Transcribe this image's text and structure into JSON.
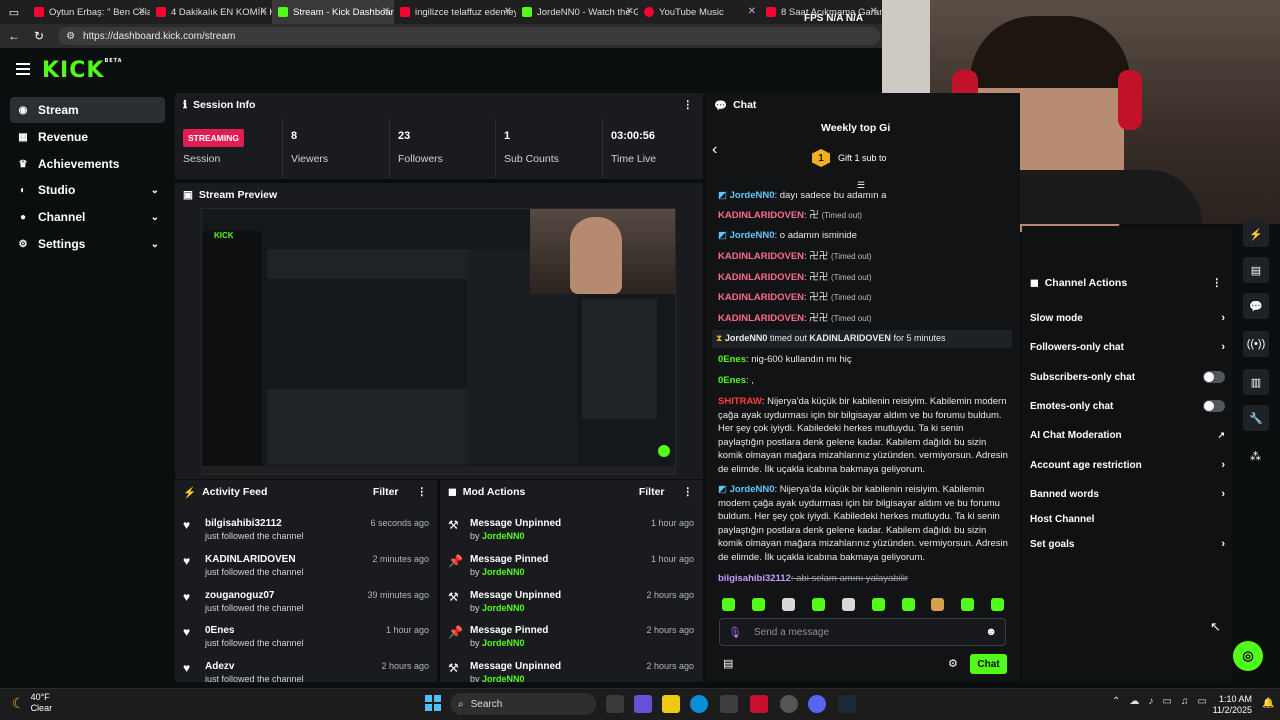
{
  "browser": {
    "tabs": [
      {
        "label": "Oytun Erbaş: \" Ben Celal",
        "color": "#ff0033"
      },
      {
        "label": "4 Dakikalık EN KOMİK Kont",
        "color": "#ff0033"
      },
      {
        "label": "Stream - Kick Dashboard",
        "color": "#53fc18"
      },
      {
        "label": "ingilizce telaffuz edemeyince",
        "color": "#ff0033"
      },
      {
        "label": "JordeNN0 - Watch the Game",
        "color": "#53fc18"
      },
      {
        "label": "YouTube Music",
        "color": "#ff0033"
      },
      {
        "label": "8 Saat Acıkmama Garantili",
        "color": "#ff0033"
      }
    ],
    "url": "https://dashboard.kick.com/stream"
  },
  "overlay": {
    "fps": "FPS",
    "na1": "N/A",
    "na2": "N/A"
  },
  "app": {
    "logo": "KICK",
    "beta": "BETA"
  },
  "sidebar": {
    "items": [
      {
        "label": "Stream",
        "icon": "broadcast-icon"
      },
      {
        "label": "Revenue",
        "icon": "bank-icon"
      },
      {
        "label": "Achievements",
        "icon": "trophy-icon"
      },
      {
        "label": "Studio",
        "icon": "palette-icon"
      },
      {
        "label": "Channel",
        "icon": "user-icon"
      },
      {
        "label": "Settings",
        "icon": "gear-icon"
      }
    ]
  },
  "session": {
    "title": "Session Info",
    "badge": "STREAMING",
    "session_label": "Session",
    "stats": [
      {
        "value": "8",
        "label": "Viewers"
      },
      {
        "value": "23",
        "label": "Followers"
      },
      {
        "value": "1",
        "label": "Sub Counts"
      },
      {
        "value": "03:00:56",
        "label": "Time Live"
      }
    ]
  },
  "preview": {
    "title": "Stream Preview"
  },
  "activity": {
    "title": "Activity Feed",
    "filter": "Filter",
    "items": [
      {
        "name": "bilgisahibi32112",
        "sub": "just followed the channel",
        "time": "6 seconds ago"
      },
      {
        "name": "KADINLARIDOVEN",
        "sub": "just followed the channel",
        "time": "2 minutes ago"
      },
      {
        "name": "zouganoguz07",
        "sub": "just followed the channel",
        "time": "39 minutes ago"
      },
      {
        "name": "0Enes",
        "sub": "just followed the channel",
        "time": "1 hour ago"
      },
      {
        "name": "Adezv",
        "sub": "just followed the channel",
        "time": "2 hours ago"
      }
    ]
  },
  "mod": {
    "title": "Mod Actions",
    "filter": "Filter",
    "by": "by",
    "items": [
      {
        "name": "Message Unpinned",
        "user": "JordeNN0",
        "time": "1 hour ago"
      },
      {
        "name": "Message Pinned",
        "user": "JordeNN0",
        "time": "1 hour ago"
      },
      {
        "name": "Message Unpinned",
        "user": "JordeNN0",
        "time": "2 hours ago"
      },
      {
        "name": "Message Pinned",
        "user": "JordeNN0",
        "time": "2 hours ago"
      },
      {
        "name": "Message Unpinned",
        "user": "JordeNN0",
        "time": "2 hours ago"
      }
    ]
  },
  "chat": {
    "title": "Chat",
    "gifter_title": "Weekly top Gi",
    "gift_text": "Gift 1 sub to",
    "gift_num": "1",
    "timeout": "(Timed out)",
    "messages": [
      {
        "user": "JordeNN0",
        "text": ": dayı sadece bu adamın a"
      },
      {
        "user": "KADINLARIDOVEN",
        "text": ": 卍"
      },
      {
        "user": "JordeNN0",
        "text": ": o adamın isminide"
      },
      {
        "user": "KADINLARIDOVEN",
        "text": ": 卍卍"
      },
      {
        "user": "KADINLARIDOVEN",
        "text": ": 卍卍"
      },
      {
        "user": "KADINLARIDOVEN",
        "text": ": 卍卍"
      },
      {
        "user": "KADINLARIDOVEN",
        "text": ": 卍卍"
      }
    ],
    "timeout_event": {
      "mod": "JordeNN0",
      "mid": "timed out",
      "target": "KADINLARIDOVEN",
      "tail": "for 5 minutes"
    },
    "m2": [
      {
        "user": "0Enes",
        "text": ": nig-600 kullandın mı hiç"
      },
      {
        "user": "0Enes",
        "text": ": ,"
      }
    ],
    "long1_user": "SHITRAW",
    "long1": ": Nijerya'da küçük bir kabilenin reisiyim. Kabilemin modern çağa ayak uydurması için bir bilgisayar aldım ve bu forumu buldum. Her şey çok iyiydi. Kabiledeki herkes mutluydu. Ta ki senin paylaştığın postlara denk gelene kadar. Kabilem dağıldı bu sizin komik olmayan mağara mizahlarınız yüzünden. vermiyorsun. Adresin de elimde. İlk uçakla icabına bakmaya geliyorum.",
    "long2_user": "JordeNN0",
    "long2": ": Nijerya'da küçük bir kabilenin reisiyim. Kabilemin modern çağa ayak uydurması için bir bilgisayar aldım ve bu forumu buldum. Her şey çok iyiydi. Kabiledeki herkes mutluydu. Ta ki senin paylaştığın postlara denk gelene kadar. Kabilem dağıldı bu sizin komik olmayan mağara mizahlarınız yüzünden. vermiyorsun. Adresin de elimde. İlk uçakla icabına bakmaya geliyorum.",
    "last_user": "bilgisahibi32112",
    "last_text": ": abi selam amını yalayabilir",
    "placeholder": "Send a message",
    "send": "Chat"
  },
  "actions": {
    "title": "Channel Actions",
    "items": [
      {
        "label": "Slow mode",
        "kind": "arrow"
      },
      {
        "label": "Followers-only chat",
        "kind": "arrow"
      },
      {
        "label": "Subscribers-only chat",
        "kind": "toggle"
      },
      {
        "label": "Emotes-only chat",
        "kind": "toggle"
      },
      {
        "label": "AI Chat Moderation",
        "kind": "external"
      },
      {
        "label": "Account age restriction",
        "kind": "arrow"
      },
      {
        "label": "Banned words",
        "kind": "arrow"
      },
      {
        "label": "Host Channel",
        "kind": "none"
      },
      {
        "label": "Set goals",
        "kind": "arrow"
      }
    ]
  },
  "taskbar": {
    "weather_temp": "40°F",
    "weather_desc": "Clear",
    "search": "Search",
    "time": "1:10 AM",
    "date": "11/2/2025"
  },
  "colors": {
    "accent": "#53fc18",
    "live": "#e11e51",
    "panel": "#191b1f"
  }
}
